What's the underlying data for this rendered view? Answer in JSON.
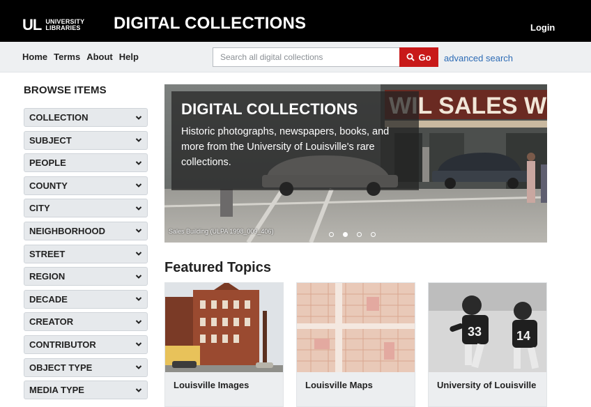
{
  "header": {
    "logo_mark": "UL",
    "logo_line1": "UNIVERSITY",
    "logo_line2": "LIBRARIES",
    "title": "DIGITAL COLLECTIONS",
    "login_label": "Login"
  },
  "nav": {
    "links": [
      "Home",
      "Terms",
      "About",
      "Help"
    ],
    "search_placeholder": "Search all digital collections",
    "go_label": "Go",
    "advanced_label": "advanced search"
  },
  "sidebar": {
    "title": "BROWSE ITEMS",
    "items": [
      "COLLECTION",
      "SUBJECT",
      "PEOPLE",
      "COUNTY",
      "CITY",
      "NEIGHBORHOOD",
      "STREET",
      "REGION",
      "DECADE",
      "CREATOR",
      "CONTRIBUTOR",
      "OBJECT TYPE",
      "MEDIA TYPE"
    ]
  },
  "hero": {
    "title": "DIGITAL COLLECTIONS",
    "text": "Historic photographs, newspapers, books, and more from the University of Louisville's rare collections.",
    "caption": "Sales Building (ULPA 1998_009_406)",
    "sign_text": "WIL SALES WO",
    "slide_count": 4,
    "active_slide": 2
  },
  "featured": {
    "title": "Featured Topics",
    "cards": [
      {
        "label": "Louisville Images",
        "image": "brick-building-photo"
      },
      {
        "label": "Louisville Maps",
        "image": "historic-map"
      },
      {
        "label": "University of Louisville",
        "image": "football-players-photo"
      }
    ]
  },
  "colors": {
    "header_bg": "#000000",
    "nav_bg": "#eef0f2",
    "go_button": "#c81919",
    "link": "#2d6bb5",
    "sidebar_item_bg": "#e6e9ec"
  }
}
